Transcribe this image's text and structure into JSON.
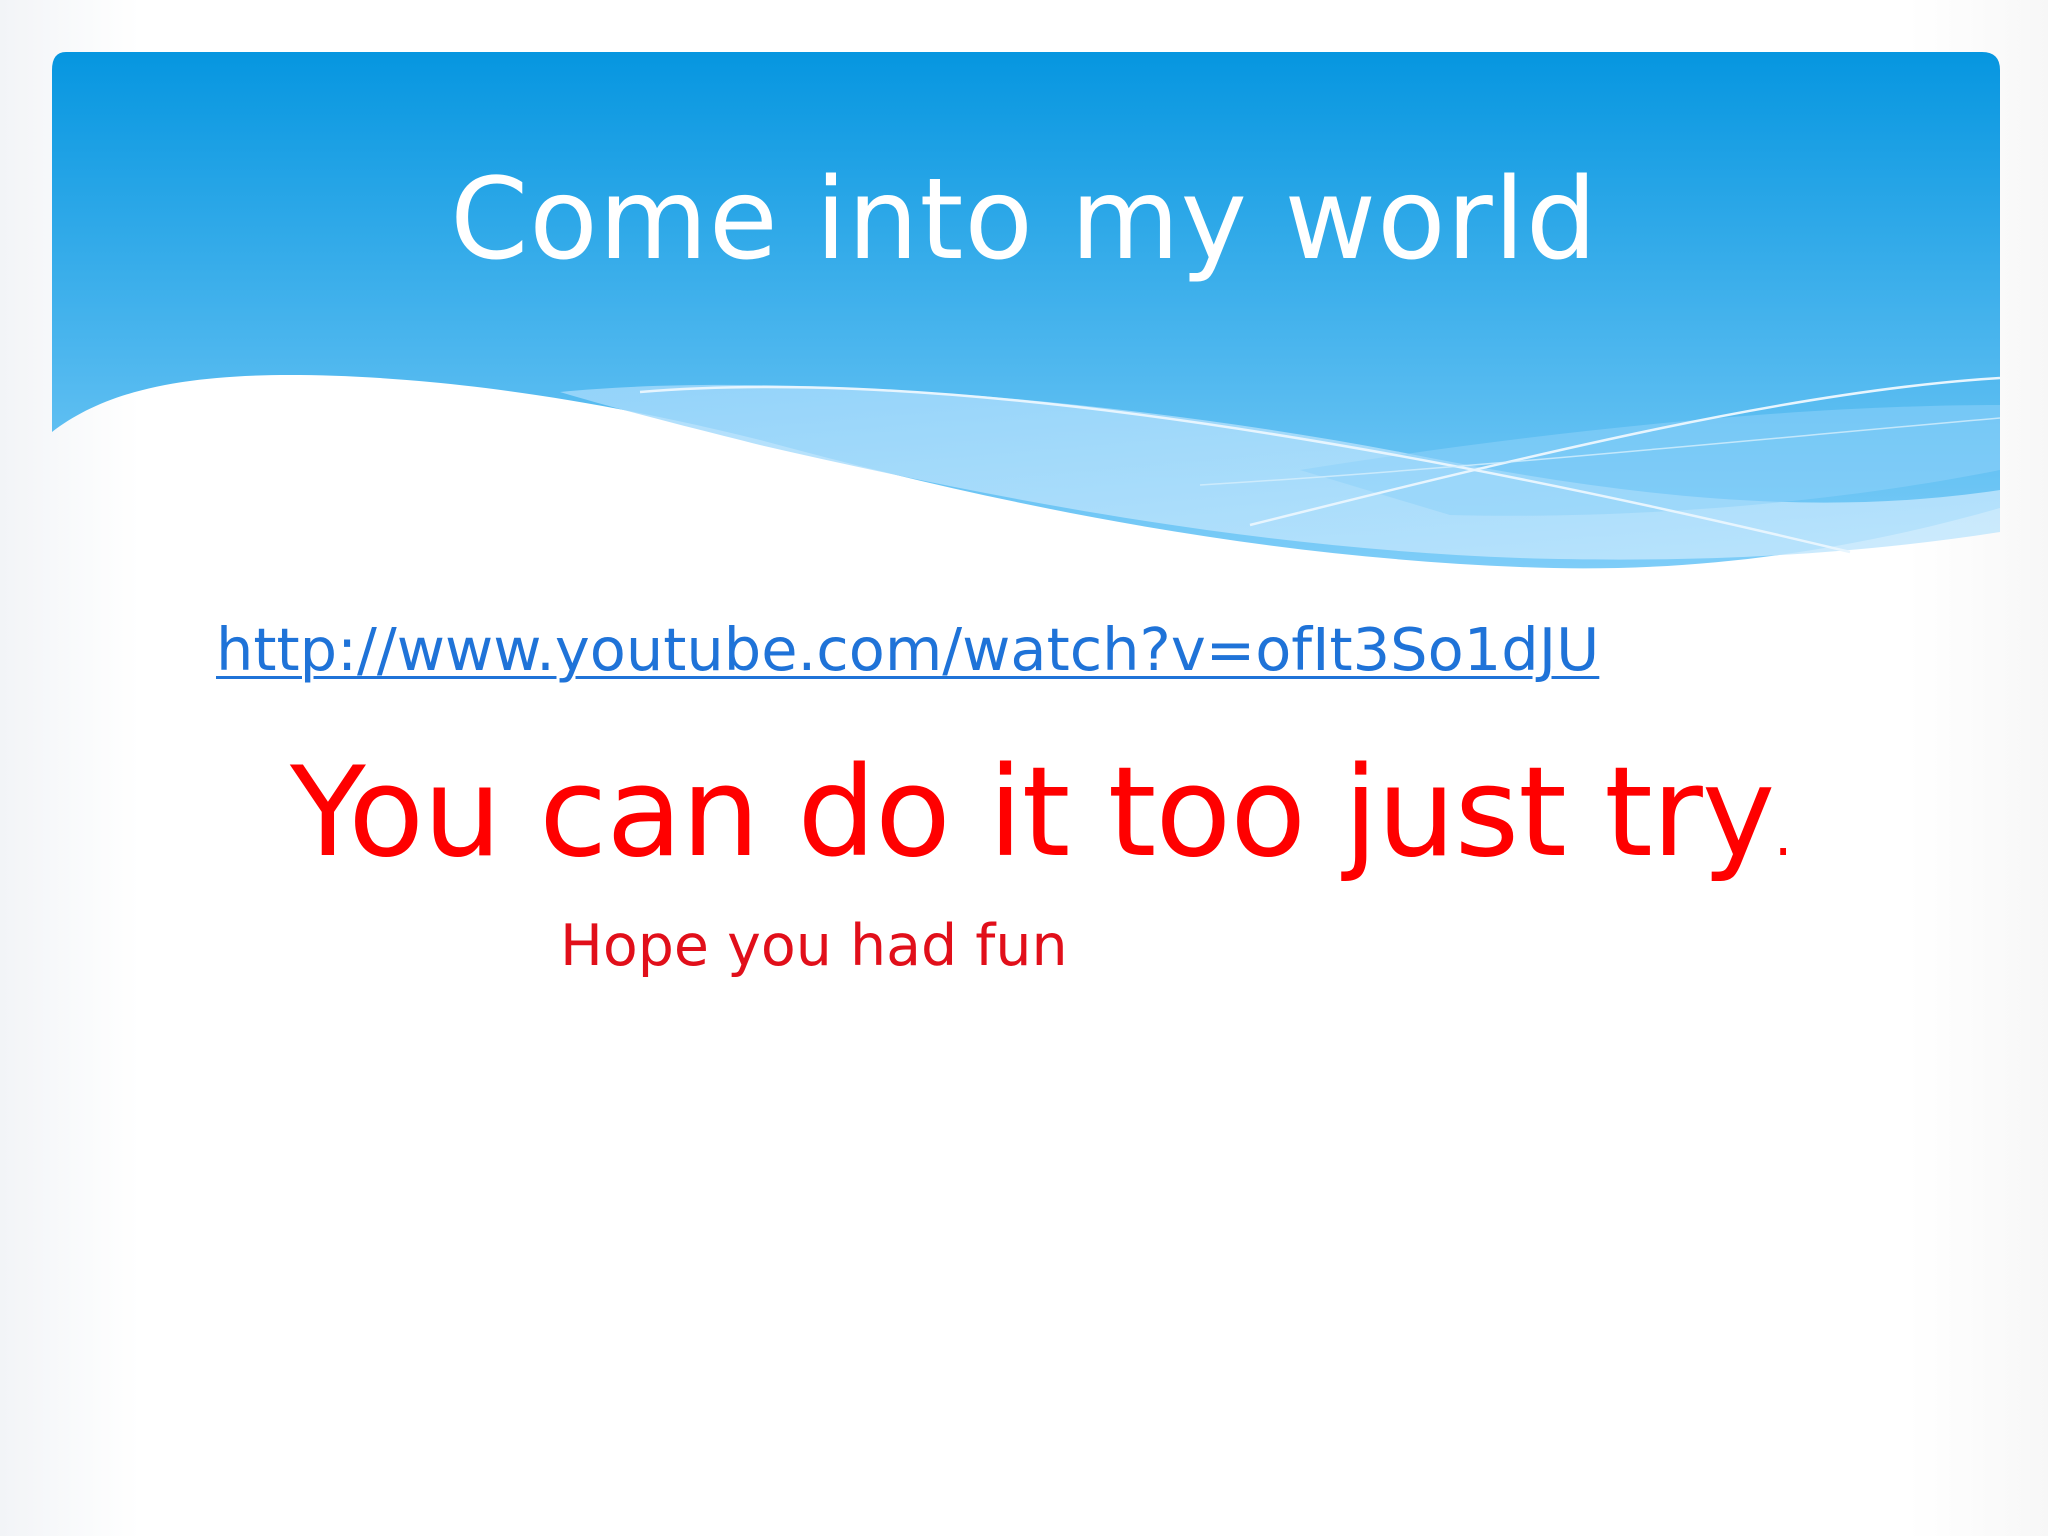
{
  "slide": {
    "title": "Come into my world",
    "link_text": "http://www.youtube.com/watch?v=ofIt3So1dJU",
    "main_message": "You can do it too just try",
    "main_message_punctuation": ".",
    "closing_message": "Hope you had fun"
  },
  "colors": {
    "header_top": "#0696e0",
    "header_bottom": "#7ecdf8",
    "title_text": "#ffffff",
    "link_text": "#1f73d8",
    "main_message": "#ff0000",
    "closing_message": "#e10f1a"
  }
}
